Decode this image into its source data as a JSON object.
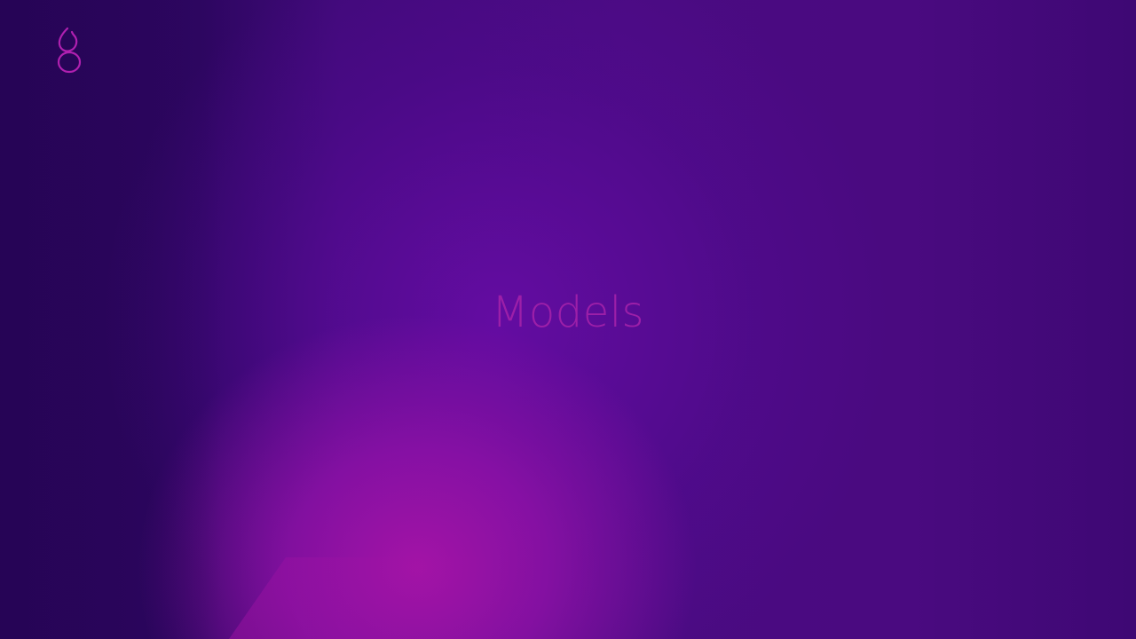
{
  "slide": {
    "title": "Models"
  },
  "logo": {
    "icon": "brand-logo-icon",
    "color": "#b020b0"
  },
  "colors": {
    "background_dark": "#2a055c",
    "background_mid": "#4a0b82",
    "glow_magenta": "#a814a8",
    "title": "#9c1fa8"
  }
}
